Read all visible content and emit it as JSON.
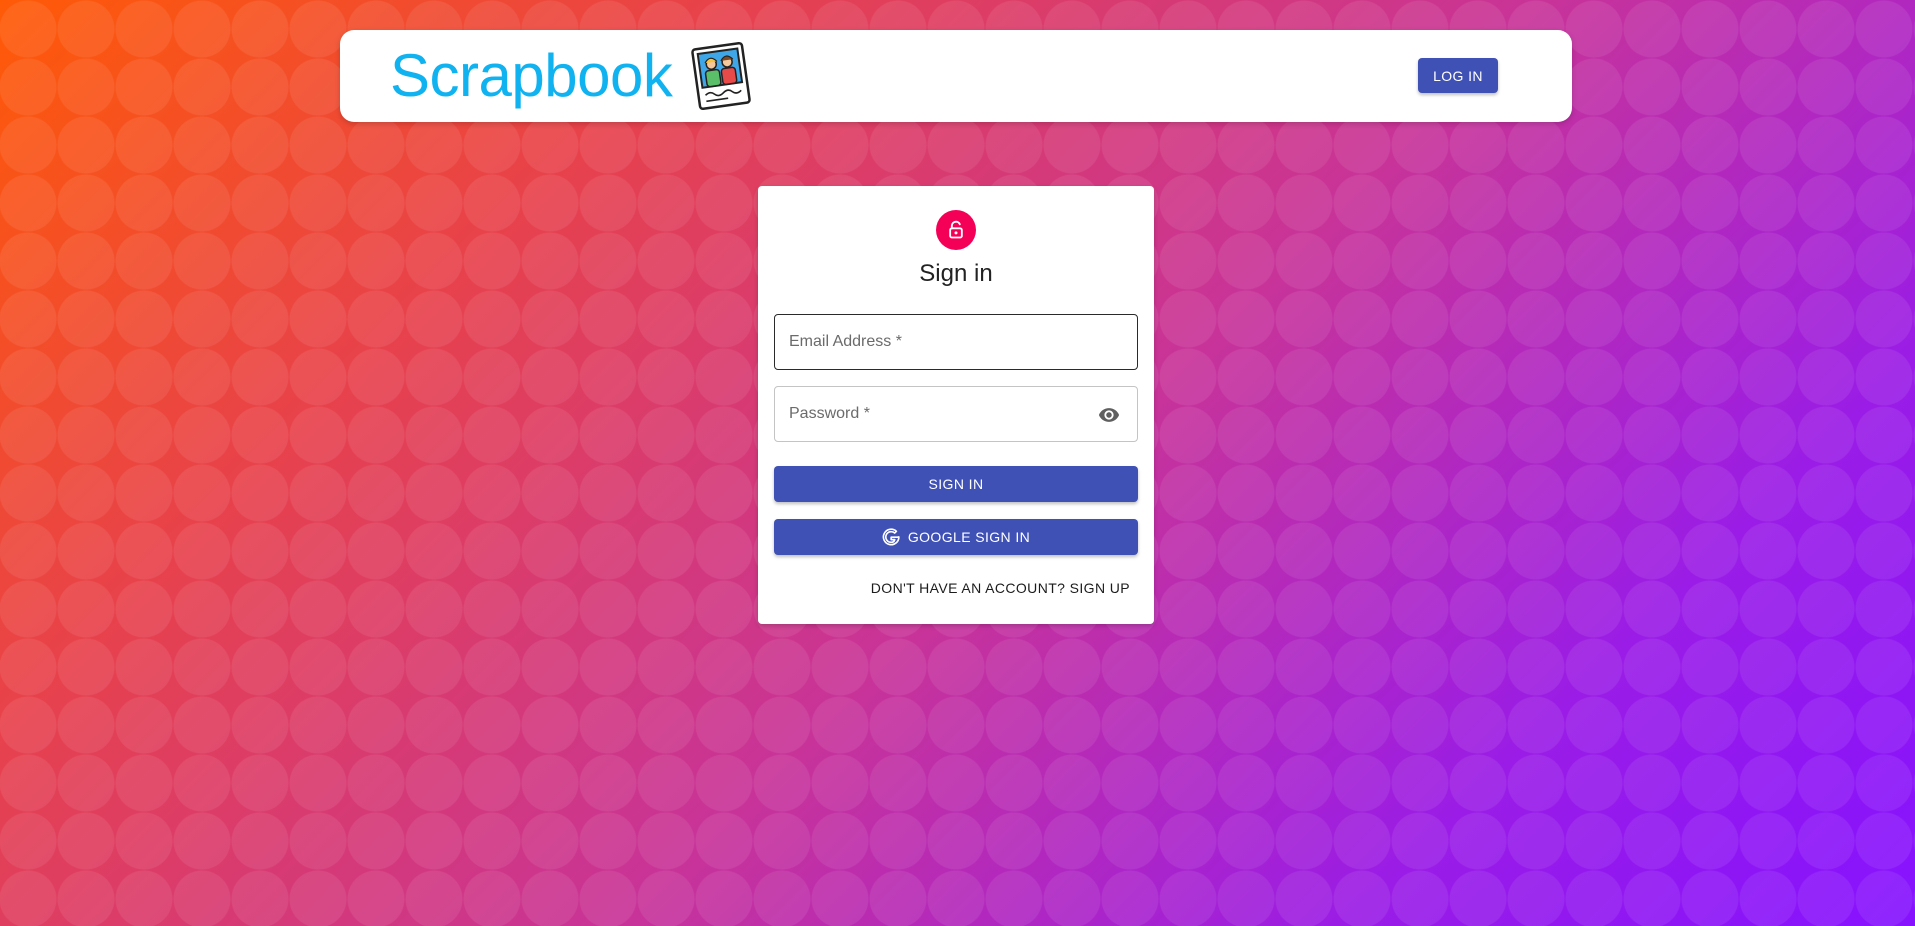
{
  "header": {
    "brand_name": "Scrapbook",
    "logo_icon": "scrapbook-photo-icon",
    "login_label": "LOG IN"
  },
  "signin": {
    "avatar_icon": "lock-icon",
    "title": "Sign in",
    "email_placeholder": "Email Address *",
    "email_value": "",
    "password_placeholder": "Password *",
    "password_value": "",
    "password_visibility_icon": "eye-icon",
    "submit_label": "SIGN IN",
    "google_label": "GOOGLE SIGN IN",
    "google_icon": "google-g-icon",
    "signup_label": "DON'T HAVE AN ACCOUNT? SIGN UP"
  },
  "colors": {
    "brand_text": "#10b2f0",
    "primary_button": "#3f51b5",
    "lock_avatar": "#f50057",
    "gradient_start": "#ff5a06",
    "gradient_end": "#8612ff"
  }
}
